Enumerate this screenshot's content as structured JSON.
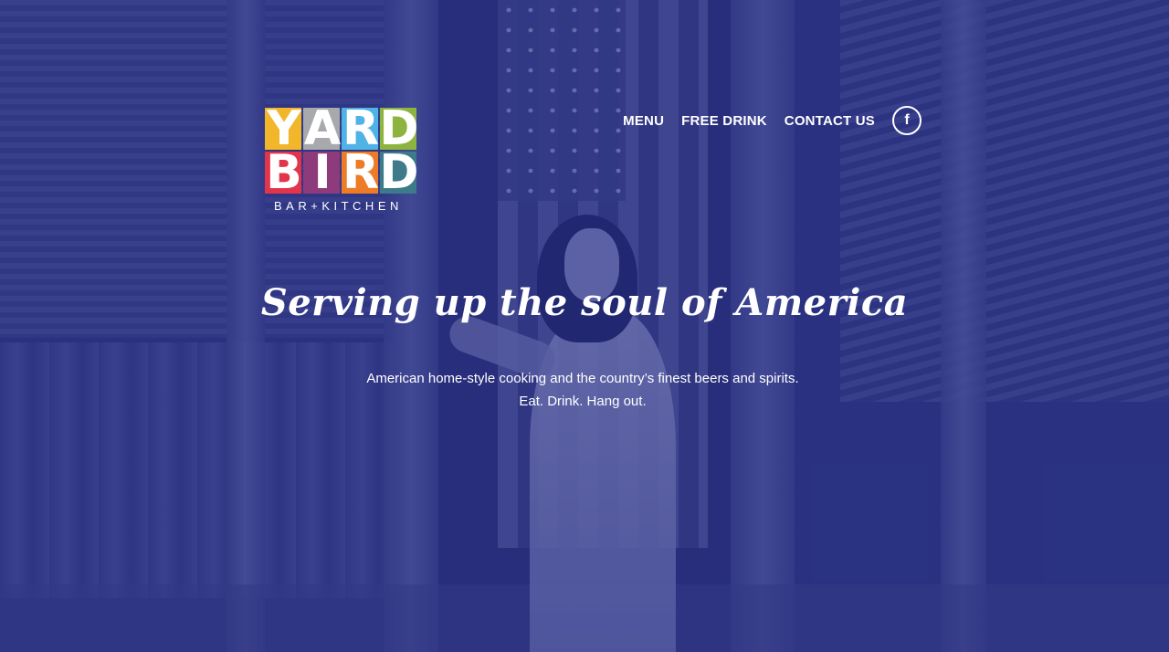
{
  "brand": {
    "logo_letters_row1": [
      "Y",
      "A",
      "R",
      "D"
    ],
    "logo_letters_row2": [
      "B",
      "I",
      "R",
      "D"
    ],
    "logo_sub": "BAR+KITCHEN",
    "colors": {
      "Y": "#f2b62a",
      "A": "#a7a9ac",
      "R1": "#4fb3e6",
      "D1": "#8cb43f",
      "B": "#e2344a",
      "I": "#8d3b7a",
      "R2": "#ee7b25",
      "D2": "#3d7a8a"
    }
  },
  "nav": {
    "items": [
      {
        "label": "MENU"
      },
      {
        "label": "FREE DRINK"
      },
      {
        "label": "CONTACT US"
      }
    ],
    "facebook_label": "f",
    "facebook_icon": "facebook-icon"
  },
  "hero": {
    "headline": "Serving up the soul of America",
    "description_line1": "American home-style cooking and the country’s finest beers and spirits.",
    "description_line2": "Eat. Drink. Hang out.",
    "overlay_color": "#2b3380"
  }
}
